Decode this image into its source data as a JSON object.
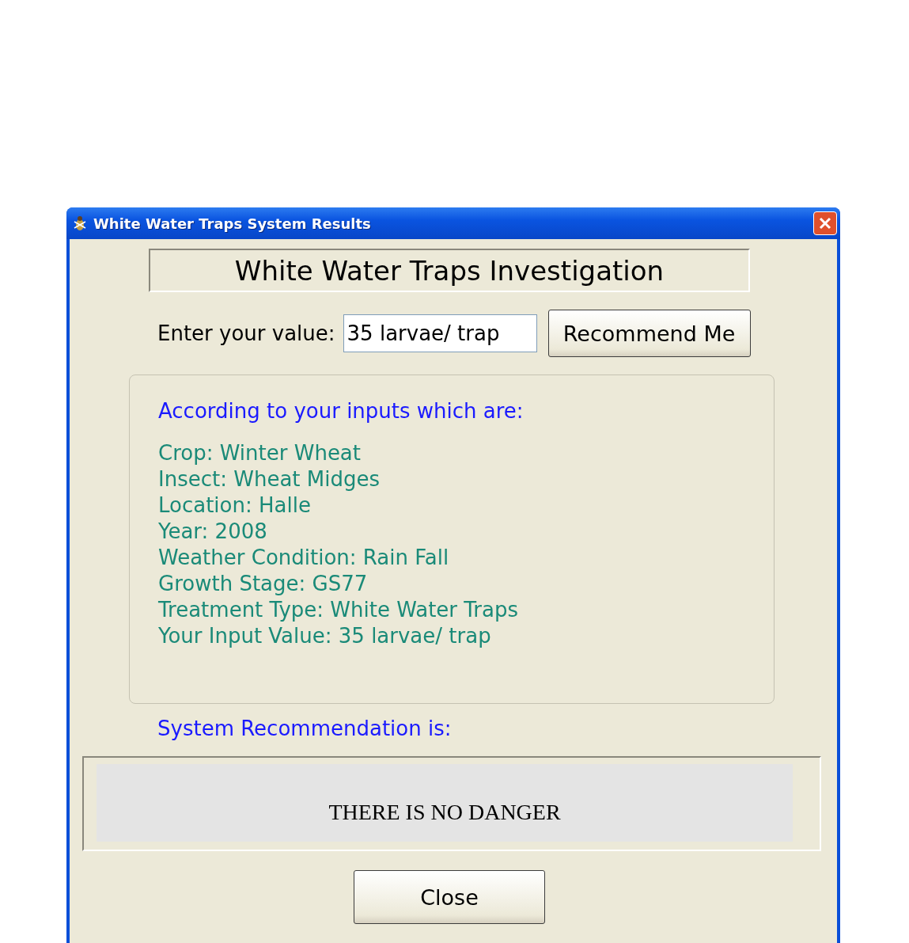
{
  "window": {
    "title": "White Water Traps System Results"
  },
  "heading": "White Water Traps Investigation",
  "input": {
    "label": "Enter your value:",
    "value": "35 larvae/ trap"
  },
  "recommend_button": "Recommend Me",
  "inputs_group": {
    "heading": "According to your inputs which are:",
    "lines": [
      "Crop: Winter Wheat",
      "Insect: Wheat Midges",
      "Location: Halle",
      "Year: 2008",
      "Weather Condition: Rain Fall",
      "Growth Stage: GS77",
      "Treatment Type: White Water Traps",
      "Your Input Value: 35 larvae/ trap"
    ]
  },
  "recommendation": {
    "label": "System Recommendation is:",
    "result": "THERE IS NO DANGER"
  },
  "close_button": "Close"
}
